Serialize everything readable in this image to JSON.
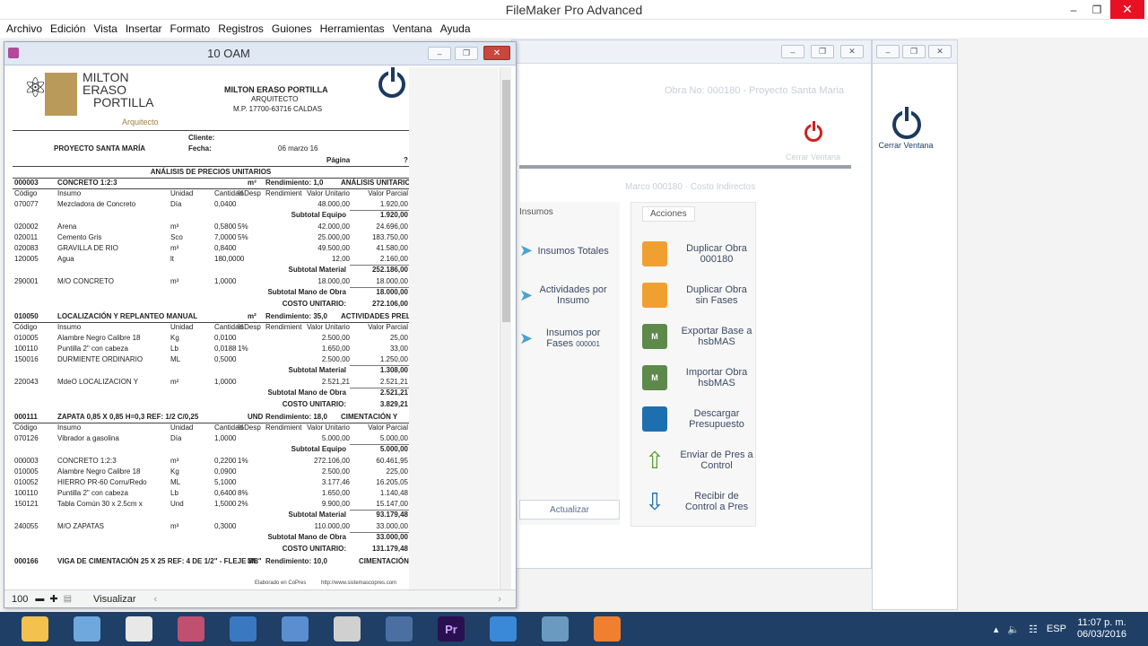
{
  "app": {
    "title": "FileMaker Pro Advanced",
    "menu": [
      "Archivo",
      "Edición",
      "Vista",
      "Insertar",
      "Formato",
      "Registros",
      "Guiones",
      "Herramientas",
      "Ventana",
      "Ayuda"
    ],
    "colors": {
      "close": "#e81123",
      "taskbar": "#1f3f67",
      "accent_orange": "#f0a030"
    }
  },
  "back_window": {
    "header_ghost": "Obra No: 000180 - Proyecto Santa Maria",
    "close_window_label": "Cerrar Ventana",
    "filter_ghost": "Marco 000180 · Costo Indirectos",
    "ghost_sub": "Cerrar Ventana",
    "tabs": [
      "Insumos",
      "Acciones"
    ],
    "insumos": [
      {
        "label": "Insumos Totales",
        "icon": "arrows-icon"
      },
      {
        "label": "Actividades por Insumo",
        "icon": "arrows-icon"
      },
      {
        "label": "Insumos por Fases",
        "suffix": "000001",
        "icon": "arrows-icon"
      }
    ],
    "update_label": "Actualizar",
    "acciones": [
      {
        "label": "Duplicar Obra 000180",
        "icon": "duplicate-icon"
      },
      {
        "label": "Duplicar Obra sin Fases",
        "icon": "duplicate-icon"
      },
      {
        "label": "Exportar Base a hsbMAS",
        "icon": "mas-icon"
      },
      {
        "label": "Importar Obra hsbMAS",
        "icon": "mas-icon"
      },
      {
        "label": "Descargar Presupuesto",
        "icon": "floppy-icon"
      },
      {
        "label": "Enviar de Pres a Control",
        "icon": "arrow-up-icon"
      },
      {
        "label": "Recibir de Control a Pres",
        "icon": "arrow-down-icon"
      }
    ]
  },
  "report_window": {
    "title": "10 OAM",
    "zoom": "100",
    "mode": "Visualizar"
  },
  "report": {
    "logo_lines": [
      "MILTON",
      "ERASO",
      "PORTILLA"
    ],
    "logo_sub": "Arquitecto",
    "company": "MILTON ERASO PORTILLA",
    "role": "ARQUITECTO",
    "license": "M.P. 17700-63716 CALDAS",
    "project": "PROYECTO SANTA MARÍA",
    "cliente_label": "Cliente:",
    "fecha_label": "Fecha:",
    "fecha": "06 marzo 16",
    "pagina_label": "Página",
    "pagina": "?",
    "section_title": "ANÁLISIS DE PRECIOS UNITARIOS",
    "col_headers": [
      "Código",
      "Insumo",
      "Unidad",
      "Cantidad",
      "%Desp",
      "Rendimient",
      "Valor Unitario",
      "Valor Parcial"
    ],
    "activities": [
      {
        "code": "000003",
        "name": "CONCRETO 1:2:3",
        "unit": "m³",
        "rend": "Rendimiento: 1,0",
        "cap": "ANÁLISIS UNITARIOS",
        "groups": [
          {
            "rows": [
              [
                "070077",
                "Mezcladora de Concreto",
                "Día",
                "0,0400",
                "",
                "",
                "48.000,00",
                "1.920,00"
              ]
            ],
            "subtotal_label": "Subtotal Equipo",
            "subtotal": "1.920,00"
          },
          {
            "rows": [
              [
                "020002",
                "Arena",
                "m³",
                "0,5800",
                "5%",
                "",
                "42.000,00",
                "24.696,00"
              ],
              [
                "020011",
                "Cemento Gris",
                "Sco",
                "7,0000",
                "5%",
                "",
                "25.000,00",
                "183.750,00"
              ],
              [
                "020083",
                "GRAVILLA DE RIO",
                "m³",
                "0,8400",
                "",
                "",
                "49.500,00",
                "41.580,00"
              ],
              [
                "120005",
                "Agua",
                "lt",
                "180,0000",
                "",
                "",
                "12,00",
                "2.160,00"
              ]
            ],
            "subtotal_label": "Subtotal Material",
            "subtotal": "252.186,00"
          },
          {
            "rows": [
              [
                "290001",
                "M/O CONCRETO",
                "m³",
                "1,0000",
                "",
                "",
                "18.000,00",
                "18.000,00"
              ]
            ],
            "subtotal_label": "Subtotal Mano de Obra",
            "subtotal": "18.000,00"
          }
        ],
        "unit_cost_label": "COSTO UNITARIO:",
        "unit_cost": "272.106,00"
      },
      {
        "code": "010050",
        "name": "LOCALIZACIÓN Y REPLANTEO MANUAL",
        "unit": "m²",
        "rend": "Rendimiento: 35,0",
        "cap": "ACTIVIDADES PRELIMINARES",
        "groups": [
          {
            "rows": [
              [
                "010005",
                "Alambre Negro Calibre 18",
                "Kg",
                "0,0100",
                "",
                "",
                "2.500,00",
                "25,00"
              ],
              [
                "100110",
                "Puntilla 2\" con cabeza",
                "Lb",
                "0,0188",
                "1%",
                "",
                "1.650,00",
                "33,00"
              ],
              [
                "150016",
                "DURMIENTE ORDINARIO",
                "ML",
                "0,5000",
                "",
                "",
                "2.500,00",
                "1.250,00"
              ]
            ],
            "subtotal_label": "Subtotal Material",
            "subtotal": "1.308,00"
          },
          {
            "rows": [
              [
                "220043",
                "MdeO LOCALIZACION Y",
                "m²",
                "1,0000",
                "",
                "",
                "2.521,21",
                "2.521,21"
              ]
            ],
            "subtotal_label": "Subtotal Mano de Obra",
            "subtotal": "2.521,21"
          }
        ],
        "unit_cost_label": "COSTO UNITARIO:",
        "unit_cost": "3.829,21"
      },
      {
        "code": "000111",
        "name": "ZAPATA 0,85 X 0,85 H=0,3 REF: 1/2 C/0,25",
        "unit": "UND",
        "rend": "Rendimiento: 18,0",
        "cap": "CIMENTACIÓN Y",
        "groups": [
          {
            "rows": [
              [
                "070126",
                "Vibrador a gasolina",
                "Día",
                "1,0000",
                "",
                "",
                "5.000,00",
                "5.000,00"
              ]
            ],
            "subtotal_label": "Subtotal Equipo",
            "subtotal": "5.000,00"
          },
          {
            "rows": [
              [
                "000003",
                "CONCRETO 1:2:3",
                "m³",
                "0,2200",
                "1%",
                "",
                "272.106,00",
                "60.461,95"
              ],
              [
                "010005",
                "Alambre Negro Calibre 18",
                "Kg",
                "0,0900",
                "",
                "",
                "2.500,00",
                "225,00"
              ],
              [
                "010052",
                "HIERRO PR-60 Corru/Redo",
                "ML",
                "5,1000",
                "",
                "",
                "3.177,46",
                "16.205,05"
              ],
              [
                "100110",
                "Puntilla 2\" con cabeza",
                "Lb",
                "0,6400",
                "8%",
                "",
                "1.650,00",
                "1.140,48"
              ],
              [
                "150121",
                "Tabla Común 30 x 2.5cm x",
                "Und",
                "1,5000",
                "2%",
                "",
                "9.900,00",
                "15.147,00"
              ]
            ],
            "subtotal_label": "Subtotal Material",
            "subtotal": "93.179,48"
          },
          {
            "rows": [
              [
                "240055",
                "M/O ZAPATAS",
                "m³",
                "0,3000",
                "",
                "",
                "110.000,00",
                "33.000,00"
              ]
            ],
            "subtotal_label": "Subtotal Mano de Obra",
            "subtotal": "33.000,00"
          }
        ],
        "unit_cost_label": "COSTO UNITARIO:",
        "unit_cost": "131.179,48"
      }
    ],
    "next_activity": {
      "code": "000166",
      "name": "VIGA DE CIMENTACIÓN 25 X 25 REF: 4 DE 1/2\" - FLEJE 3/8\"",
      "unit": "ML",
      "rend": "Rendimiento: 10,0",
      "cap": "CIMENTACIÓN Y"
    },
    "footer_left": "Elaborado en CoPres",
    "footer_right": "http://www.sistemascopres.com"
  },
  "taskbar": {
    "apps": [
      "explorer-icon",
      "calculator-icon",
      "chrome-icon",
      "app-icon",
      "app-icon",
      "app-icon",
      "itunes-icon",
      "video-icon",
      "premiere-icon",
      "app-icon",
      "app-icon",
      "app-icon"
    ],
    "premiere_label": "Pr",
    "lang": "ESP",
    "time": "11:07 p. m.",
    "date": "06/03/2016"
  }
}
